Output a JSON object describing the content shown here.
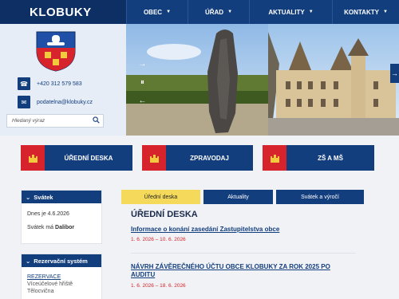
{
  "header": {
    "logo": "KLOBUKY",
    "nav": [
      {
        "label": "OBEC"
      },
      {
        "label": "ÚŘAD"
      },
      {
        "label": "AKTUALITY"
      },
      {
        "label": "KONTAKTY"
      }
    ]
  },
  "contact": {
    "phone": "+420 312 579 583",
    "email": "podatelna@klobuky.cz"
  },
  "search": {
    "placeholder": "Hledaný výraz"
  },
  "quick_links": [
    {
      "label": "ÚŘEDNÍ DESKA"
    },
    {
      "label": "ZPRAVODAJ"
    },
    {
      "label": "ZŠ A MŠ"
    }
  ],
  "holiday": {
    "title": "Svátek",
    "today": "Dnes je 4.6.2026",
    "name_prefix": "Svátek má ",
    "name": "Dalibor"
  },
  "reservation": {
    "title": "Rezervační systém",
    "link": "REZERVACE",
    "line1": "Víceúčelové hřiště",
    "line2": "Tělocvična"
  },
  "tabs": [
    {
      "label": "Úřední deska"
    },
    {
      "label": "Aktuality"
    },
    {
      "label": "Svátek a výročí"
    }
  ],
  "section": {
    "title": "ÚŘEDNÍ DESKA"
  },
  "news": [
    {
      "title": "Informace o konání zasedání Zastupitelstva obce",
      "date": "1. 6. 2026 – 10. 6. 2026"
    },
    {
      "title_line1": "NÁVRH ZÁVĚREČNÉHO ÚČTU OBCE KLOBUKY ZA ROK 2025 PO",
      "title_line2": "AUDITU",
      "date": "1. 6. 2026 – 18. 6. 2026"
    }
  ],
  "colors": {
    "navy": "#133e7e",
    "red": "#d7242c",
    "tab_active": "#f5d95a"
  }
}
